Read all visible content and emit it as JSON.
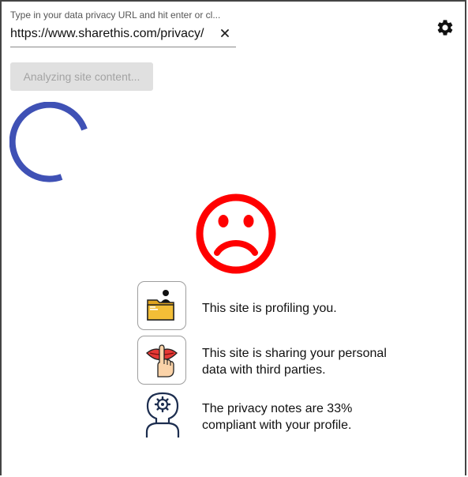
{
  "url_input": {
    "label": "Type in your data privacy URL and hit enter or cl...",
    "value": "https://www.sharethis.com/privacy/",
    "clear_icon": "close-icon"
  },
  "settings": {
    "icon": "gear-icon"
  },
  "analyze_button": {
    "label": "Analyzing site content..."
  },
  "spinner": {
    "icon": "loading-spinner",
    "color": "#3f51b5"
  },
  "result": {
    "icon": "sad-face-icon",
    "color": "#ff0000"
  },
  "findings": [
    {
      "icon": "profiling-folder-icon",
      "text": "This site is profiling you."
    },
    {
      "icon": "secret-sharing-icon",
      "text": "This site is sharing your personal data with third parties."
    },
    {
      "icon": "profile-head-gear-icon",
      "text": "The privacy notes are 33% compliant with your profile."
    }
  ]
}
